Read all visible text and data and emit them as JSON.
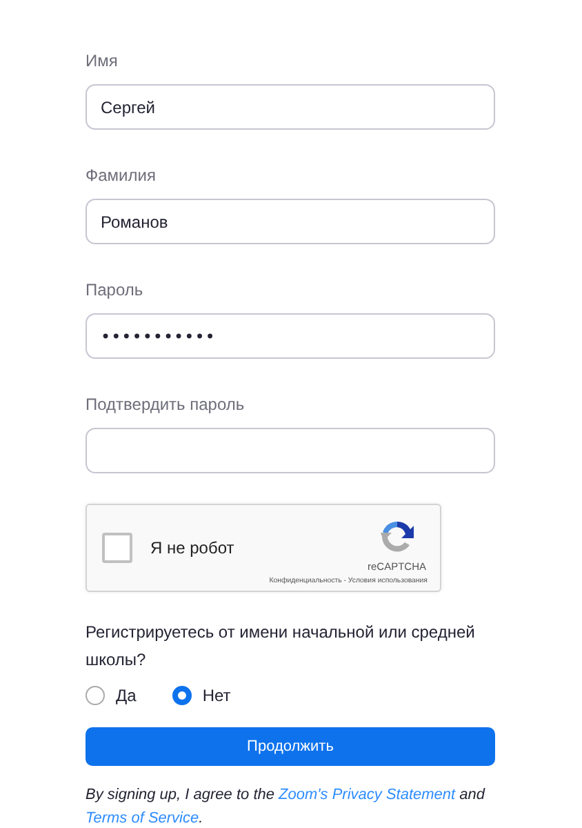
{
  "fields": [
    {
      "label": "Имя",
      "value": "Сергей"
    },
    {
      "label": "Фамилия",
      "value": "Романов"
    },
    {
      "label": "Пароль",
      "value": "•••••••••••"
    },
    {
      "label": "Подтвердить пароль"
    }
  ],
  "captcha": {
    "label": "Я не робот",
    "checked": false,
    "brand": "reCAPTCHA",
    "links": "Конфиденциальность - Условия использования"
  },
  "question": "Регистрируетесь от имени начальной или средней школы?",
  "options": [
    {
      "label": "Да",
      "selected": false
    },
    {
      "label": "Нет",
      "selected": true
    }
  ],
  "submit": "Продолжить",
  "terms": [
    {
      "kind": "text",
      "text": "By signing up, I agree to the "
    },
    {
      "kind": "link",
      "text": "Zoom's Privacy Statement"
    },
    {
      "kind": "text",
      "text": " and "
    },
    {
      "kind": "link",
      "text": "Terms of Service"
    },
    {
      "kind": "text",
      "text": "."
    }
  ]
}
